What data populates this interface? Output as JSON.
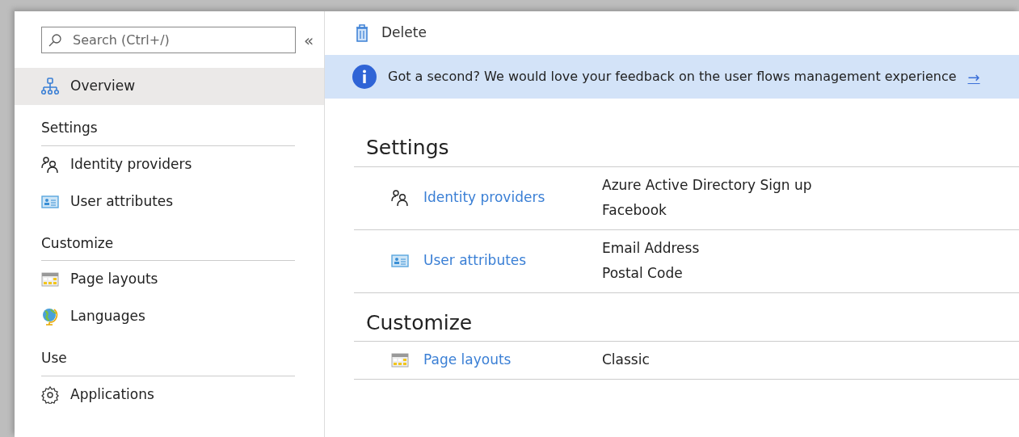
{
  "sidebar": {
    "search": {
      "placeholder": "Search (Ctrl+/)"
    },
    "collapse": "«",
    "items": [
      {
        "label": "Overview",
        "kind": "network",
        "selected": true
      }
    ],
    "sections": [
      {
        "heading": "Settings",
        "items": [
          {
            "label": "Identity providers",
            "kind": "people",
            "selected": false
          },
          {
            "label": "User attributes",
            "kind": "card",
            "selected": false
          }
        ]
      },
      {
        "heading": "Customize",
        "items": [
          {
            "label": "Page layouts",
            "kind": "layout",
            "selected": false
          },
          {
            "label": "Languages",
            "kind": "globe",
            "selected": false
          }
        ]
      },
      {
        "heading": "Use",
        "items": [
          {
            "label": "Applications",
            "kind": "gear",
            "selected": false
          }
        ]
      }
    ]
  },
  "toolbar": [
    {
      "label": "Delete",
      "kind": "trash"
    }
  ],
  "banner": {
    "text": "Got a second? We would love your feedback on the user flows management experience",
    "arrow": "→"
  },
  "groups": [
    {
      "heading": "Settings",
      "rows": [
        {
          "label": "Identity providers",
          "kind": "people",
          "values": [
            "Azure Active Directory Sign up",
            "Facebook"
          ]
        },
        {
          "label": "User attributes",
          "kind": "card",
          "values": [
            "Email Address",
            "Postal Code"
          ]
        }
      ]
    },
    {
      "heading": "Customize",
      "rows": [
        {
          "label": "Page layouts",
          "kind": "layout",
          "values": [
            "Classic"
          ]
        }
      ]
    }
  ]
}
